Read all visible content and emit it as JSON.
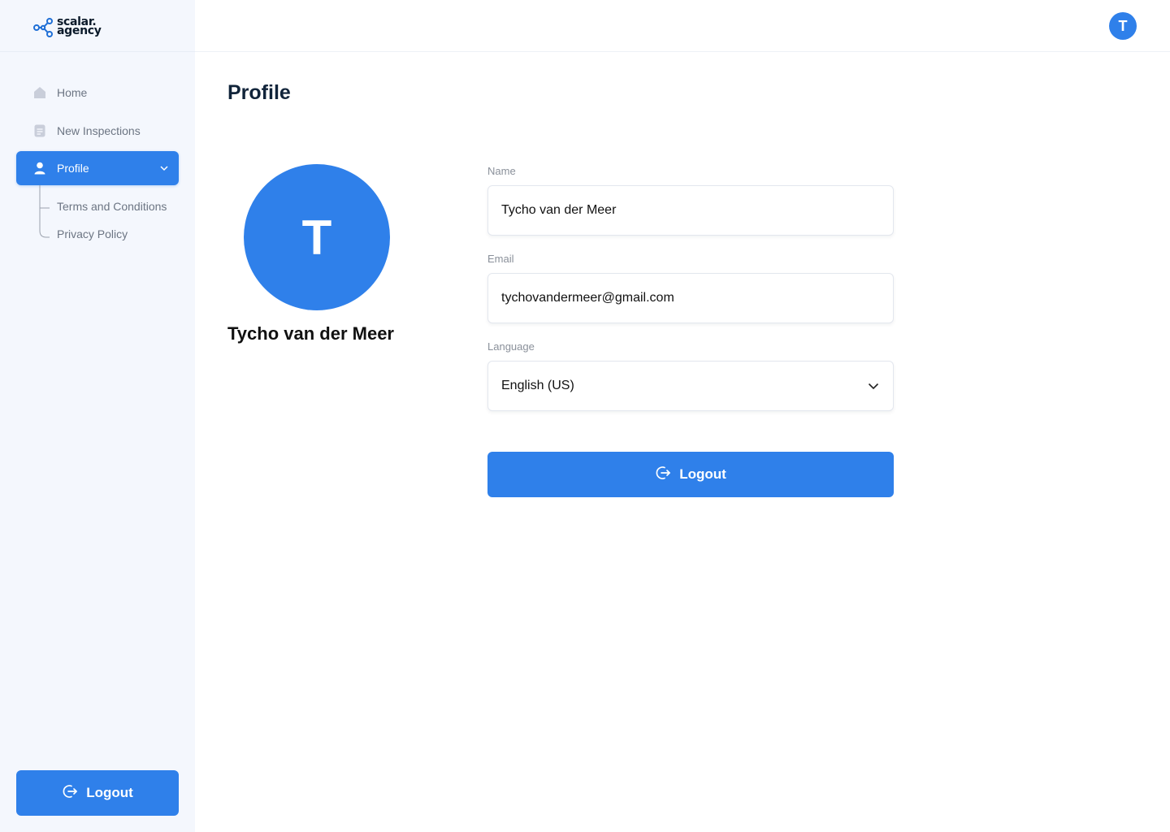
{
  "brand": {
    "line1": "scalar.",
    "line2": "agency",
    "accent": "#2f80ea"
  },
  "sidebar": {
    "items": [
      {
        "label": "Home",
        "icon": "home-icon"
      },
      {
        "label": "New Inspections",
        "icon": "document-icon"
      },
      {
        "label": "Profile",
        "icon": "user-icon",
        "active": true,
        "expanded": true
      }
    ],
    "sub_items": [
      {
        "label": "Terms and Conditions"
      },
      {
        "label": "Privacy Policy"
      }
    ],
    "logout_label": "Logout"
  },
  "topbar": {
    "avatar_initial": "T"
  },
  "main": {
    "title": "Profile",
    "avatar_initial": "T",
    "user_name": "Tycho van der Meer",
    "fields": {
      "name": {
        "label": "Name",
        "value": "Tycho van der Meer"
      },
      "email": {
        "label": "Email",
        "value": "tychovandermeer@gmail.com"
      },
      "language": {
        "label": "Language",
        "value": "English (US)"
      }
    },
    "logout_label": "Logout"
  }
}
